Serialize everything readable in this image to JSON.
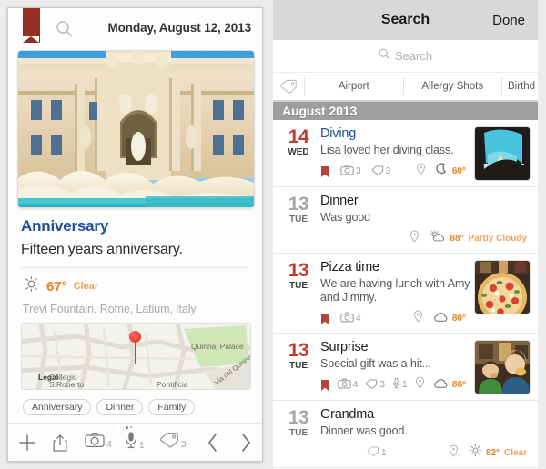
{
  "left": {
    "header": {
      "bookmark_icon": "ribbon-bookmark-icon",
      "search_icon": "search-icon",
      "date": "Monday, August 12, 2013"
    },
    "hero_photo_alt": "Trevi Fountain photo",
    "entry": {
      "title": "Anniversary",
      "text": "Fifteen years anniversary.",
      "weather": {
        "icon": "sun-icon",
        "temp": "67°",
        "condition": "Clear"
      },
      "location": "Trevi Fountain, Rome, Latium, Italy"
    },
    "map": {
      "attribution": "Legal",
      "labels": [
        "Collegio",
        "S.Roberto",
        "Pontificia",
        "Quirinal Palace",
        "Via del Quirinale"
      ],
      "pin_icon": "map-pin-icon"
    },
    "tags": [
      "Anniversary",
      "Dinner",
      "Family"
    ],
    "toolbar": [
      {
        "icon": "plus-icon",
        "count": ""
      },
      {
        "icon": "share-icon",
        "count": ""
      },
      {
        "icon": "camera-icon",
        "count": "4"
      },
      {
        "icon": "microphone-icon",
        "count": "1"
      },
      {
        "icon": "tag-icon",
        "count": "3"
      },
      {
        "icon": "chevron-left-icon",
        "count": ""
      },
      {
        "icon": "chevron-right-icon",
        "count": ""
      }
    ]
  },
  "right": {
    "nav": {
      "title": "Search",
      "done_label": "Done"
    },
    "search": {
      "placeholder": "Search",
      "icon": "search-icon"
    },
    "tag_tabs": {
      "icon": "tag-icon",
      "items": [
        "Airport",
        "Allergy Shots",
        "Birthd"
      ]
    },
    "month_header": "August 2013",
    "entries": [
      {
        "day": "14",
        "dow": "WED",
        "day_color": "red",
        "title": "Diving",
        "title_color": "blue",
        "note": "Lisa loved her diving class.",
        "meta": [
          {
            "icon": "bookmark-icon",
            "count": ""
          },
          {
            "icon": "camera-icon",
            "count": "3"
          },
          {
            "icon": "tag-icon",
            "count": "3"
          }
        ],
        "location_icon": "map-pin-icon",
        "weather": {
          "icon": "moon-icon",
          "temp": "60°",
          "condition": ""
        },
        "thumb": "beach-cave"
      },
      {
        "day": "13",
        "dow": "TUE",
        "day_color": "gray",
        "title": "Dinner",
        "title_color": "dark",
        "note": "Was good",
        "meta": [],
        "location_icon": "map-pin-icon",
        "weather": {
          "icon": "partly-cloudy-icon",
          "temp": "88°",
          "condition": "Partly Cloudy"
        },
        "thumb": ""
      },
      {
        "day": "13",
        "dow": "TUE",
        "day_color": "red",
        "title": "Pizza time",
        "title_color": "dark",
        "note": "We are having lunch with Amy and Jimmy.",
        "meta": [
          {
            "icon": "bookmark-icon",
            "count": ""
          },
          {
            "icon": "camera-icon",
            "count": "4"
          }
        ],
        "location_icon": "map-pin-icon",
        "weather": {
          "icon": "cloud-icon",
          "temp": "80°",
          "condition": ""
        },
        "thumb": "pizza"
      },
      {
        "day": "13",
        "dow": "TUE",
        "day_color": "red",
        "title": "Surprise",
        "title_color": "dark",
        "note": "Special gift was a hit...",
        "meta": [
          {
            "icon": "bookmark-icon",
            "count": ""
          },
          {
            "icon": "camera-icon",
            "count": "4"
          },
          {
            "icon": "tag-icon",
            "count": "3"
          },
          {
            "icon": "microphone-icon",
            "count": "1"
          }
        ],
        "location_icon": "map-pin-icon",
        "weather": {
          "icon": "cloud-icon",
          "temp": "86°",
          "condition": ""
        },
        "thumb": "people"
      },
      {
        "day": "13",
        "dow": "TUE",
        "day_color": "gray",
        "title": "Grandma",
        "title_color": "dark",
        "note": "Dinner was good.",
        "meta": [
          {
            "icon": "tag-icon",
            "count": "1"
          }
        ],
        "location_icon": "map-pin-icon",
        "weather": {
          "icon": "sun-icon",
          "temp": "82°",
          "condition": "Clear"
        },
        "thumb": ""
      }
    ]
  },
  "colors": {
    "accent_blue": "#1c4f9c",
    "accent_red": "#c0392b",
    "ribbon_red": "#9b3226",
    "weather_orange": "#f08020",
    "month_gray": "#9e9e9e"
  }
}
